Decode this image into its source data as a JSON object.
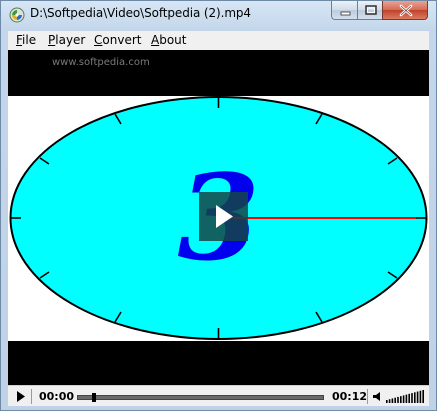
{
  "window": {
    "title": "D:\\Softpedia\\Video\\Softpedia (2).mp4",
    "icon": "media-player-icon"
  },
  "menu": {
    "items": [
      {
        "label_pre": "",
        "label_ul": "F",
        "label_post": "ile"
      },
      {
        "label_pre": "",
        "label_ul": "P",
        "label_post": "layer"
      },
      {
        "label_pre": "",
        "label_ul": "C",
        "label_post": "onvert"
      },
      {
        "label_pre": "",
        "label_ul": "A",
        "label_post": "bout"
      }
    ]
  },
  "video": {
    "watermark": "www.softpedia.com",
    "countdown_digit": "3",
    "clock_color": "#00ffff",
    "hand_color": "#ff0000",
    "digit_color": "#0000ee"
  },
  "controls": {
    "current_time": "00:00",
    "duration": "00:12",
    "progress": 0.0,
    "volume": 1.0
  }
}
